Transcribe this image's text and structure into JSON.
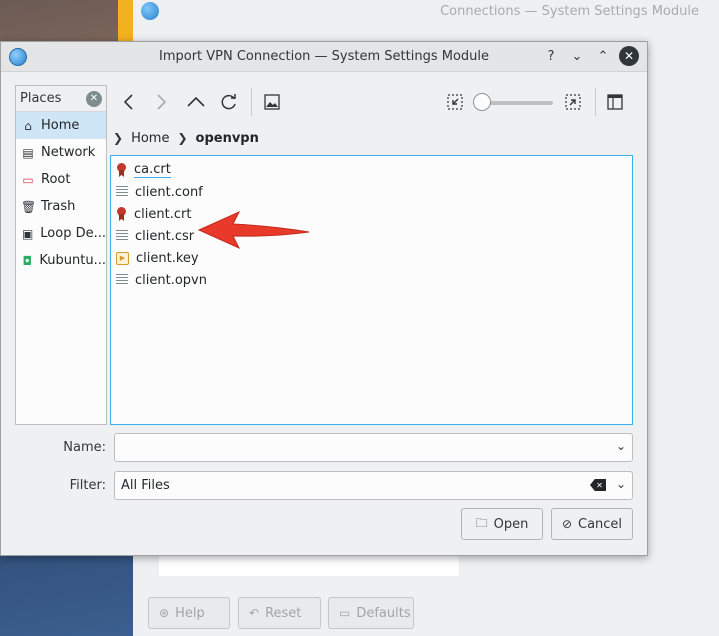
{
  "background": {
    "title": "Connections — System Settings Module",
    "buttons": {
      "help": "Help",
      "reset": "Reset",
      "defaults": "Defaults"
    }
  },
  "dialog": {
    "title": "Import VPN Connection — System Settings Module",
    "titlebar_buttons": {
      "help": "?",
      "minimize": "⌄",
      "maximize": "⌃",
      "close": "✕"
    }
  },
  "places": {
    "header": "Places",
    "items": [
      {
        "label": "Home",
        "icon": "home-icon",
        "active": true
      },
      {
        "label": "Network",
        "icon": "network-icon"
      },
      {
        "label": "Root",
        "icon": "root-folder-icon"
      },
      {
        "label": "Trash",
        "icon": "trash-icon"
      },
      {
        "label": "Loop De...",
        "icon": "loop-device-icon"
      },
      {
        "label": "Kubuntu...",
        "icon": "drive-icon"
      }
    ]
  },
  "breadcrumb": {
    "items": [
      "Home",
      "openvpn"
    ]
  },
  "files": [
    {
      "name": "ca.crt",
      "icon": "certificate-icon"
    },
    {
      "name": "client.conf",
      "icon": "text-file-icon"
    },
    {
      "name": "client.crt",
      "icon": "certificate-icon"
    },
    {
      "name": "client.csr",
      "icon": "text-file-icon"
    },
    {
      "name": "client.key",
      "icon": "key-file-icon"
    },
    {
      "name": "client.opvn",
      "icon": "text-file-icon"
    }
  ],
  "form": {
    "name_label": "Name:",
    "name_value": "",
    "filter_label": "Filter:",
    "filter_value": "All Files"
  },
  "buttons": {
    "open": "Open",
    "cancel": "Cancel"
  },
  "colors": {
    "accent": "#3daee9",
    "selection": "#cfe6f7",
    "arrow": "#e8392a"
  }
}
